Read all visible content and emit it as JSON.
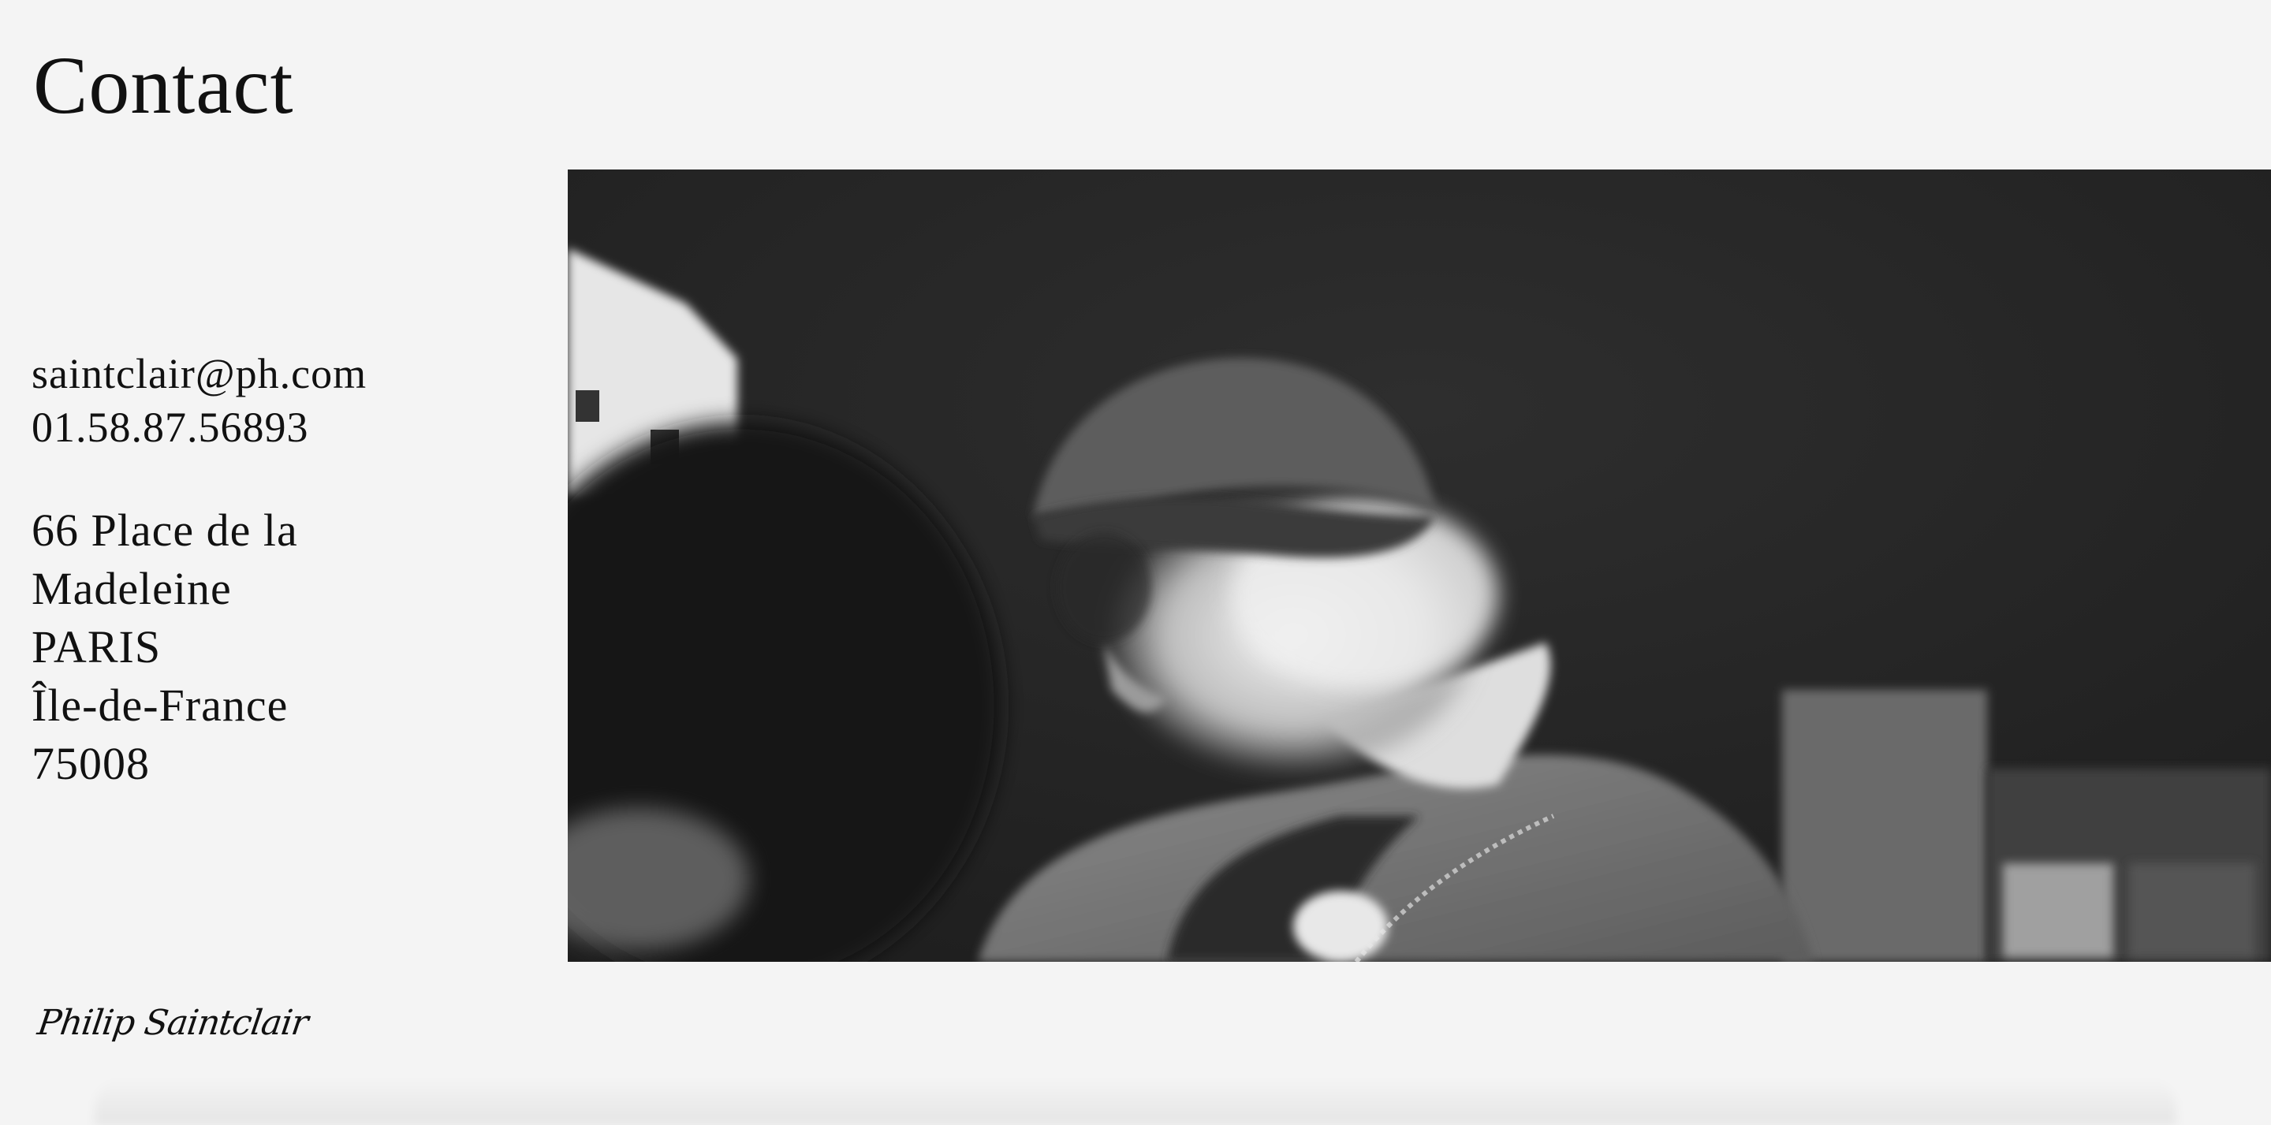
{
  "page": {
    "title": "Contact"
  },
  "contact": {
    "email": "saintclair@ph.com",
    "phone": "01.58.87.56893",
    "address_line1": "66 Place de la",
    "address_line2": "Madeleine",
    "city": "PARIS",
    "region": "Île-de-France",
    "postal_code": "75008"
  },
  "footer": {
    "signature": "Philip Saintclair"
  },
  "colors": {
    "background": "#f4f4f4",
    "text": "#111111",
    "photo_dark": "#2a2a2a"
  }
}
